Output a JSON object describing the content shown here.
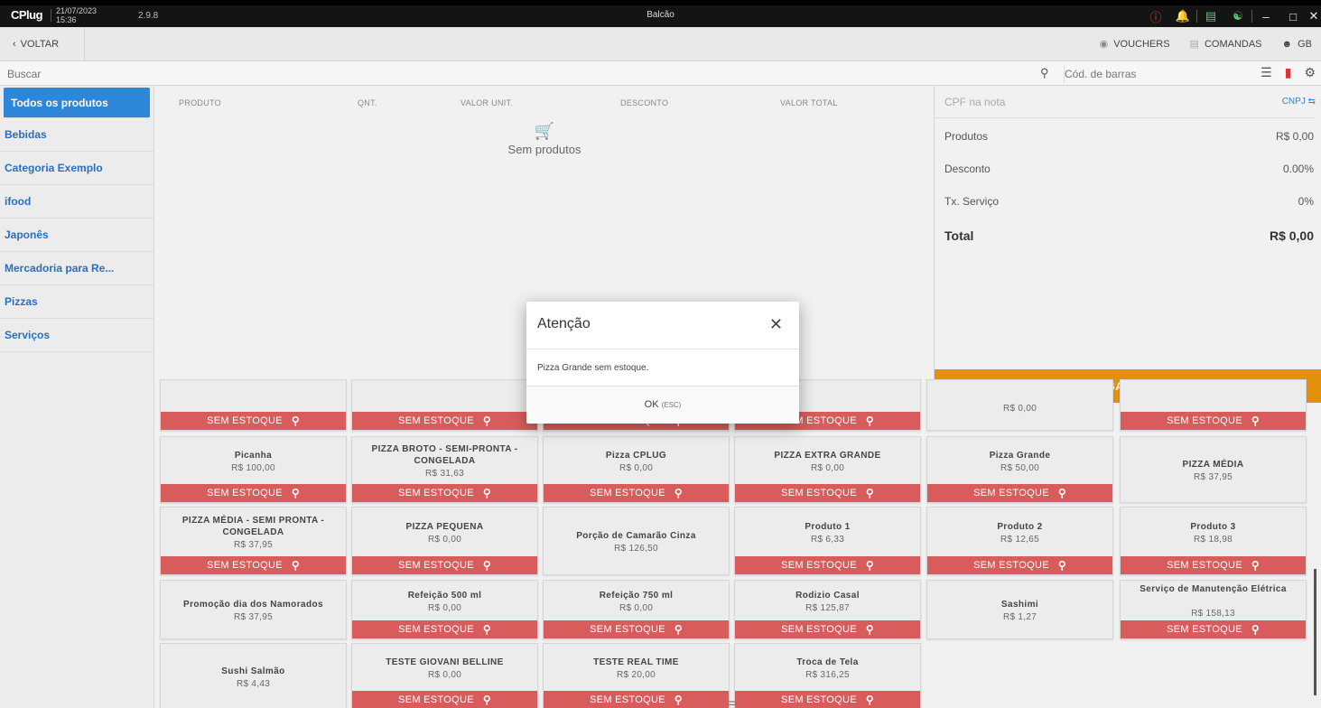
{
  "titlebar": {
    "logo": "CPlug",
    "date": "21/07/2023",
    "time": "15:36",
    "version": "2.9.8",
    "title": "Balcão"
  },
  "nav": {
    "back": "VOLTAR",
    "vouchers": "VOUCHERS",
    "comandas": "COMANDAS",
    "user": "GB"
  },
  "search": {
    "placeholder": "Buscar",
    "barcode_placeholder": "Cód. de barras"
  },
  "categories": [
    "Todos os produtos",
    "Bebidas",
    "Categoria Exemplo",
    "ifood",
    "Japonês",
    "Mercadoria para Re...",
    "Pizzas",
    "Serviços"
  ],
  "order": {
    "headers": [
      "PRODUTO",
      "QNT.",
      "VALOR UNIT.",
      "DESCONTO",
      "VALOR TOTAL"
    ],
    "empty": "Sem produtos"
  },
  "summary": {
    "cpf_placeholder": "CPF na nota",
    "cnpj": "CNPJ",
    "produtos_label": "Produtos",
    "produtos_value": "R$ 0,00",
    "desconto_label": "Desconto",
    "desconto_value": "0.00%",
    "servico_label": "Tx. Serviço",
    "servico_value": "0%",
    "total_label": "Total",
    "total_value": "R$ 0,00",
    "pay": "PAGAMENTO"
  },
  "stock_label": "SEM ESTOQUE",
  "row0_price": "R$ 0,00",
  "products": [
    {
      "name": "Picanha",
      "price": "R$ 100,00"
    },
    {
      "name": "PIZZA BROTO - SEMI-PRONTA - CONGELADA",
      "price": "R$ 31,63"
    },
    {
      "name": "Pizza CPLUG",
      "price": "R$ 0,00"
    },
    {
      "name": "PIZZA EXTRA GRANDE",
      "price": "R$ 0,00"
    },
    {
      "name": "Pizza Grande",
      "price": "R$ 50,00"
    },
    {
      "name": "PIZZA MÉDIA",
      "price": "R$ 37,95"
    },
    {
      "name": "PIZZA MÉDIA - SEMI PRONTA - CONGELADA",
      "price": "R$ 37,95"
    },
    {
      "name": "PIZZA PEQUENA",
      "price": "R$ 0,00"
    },
    {
      "name": "Porção de Camarão Cinza",
      "price": "R$ 126,50"
    },
    {
      "name": "Produto 1",
      "price": "R$ 6,33"
    },
    {
      "name": "Produto 2",
      "price": "R$ 12,65"
    },
    {
      "name": "Produto 3",
      "price": "R$ 18,98"
    },
    {
      "name": "Promoção dia dos Namorados",
      "price": "R$ 37,95"
    },
    {
      "name": "Refeição 500 ml",
      "price": "R$ 0,00"
    },
    {
      "name": "Refeição 750 ml",
      "price": "R$ 0,00"
    },
    {
      "name": "Rodizio Casal",
      "price": "R$ 125,87"
    },
    {
      "name": "Sashimi",
      "price": "R$ 1,27"
    },
    {
      "name": "Serviço de Manutenção Elétrica",
      "price": "R$ 158,13"
    },
    {
      "name": "Sushi Salmão",
      "price": "R$ 4,43"
    },
    {
      "name": "TESTE GIOVANI BELLINE",
      "price": "R$ 0,00"
    },
    {
      "name": "TESTE REAL TIME",
      "price": "R$ 20,00"
    },
    {
      "name": "Troca de Tela",
      "price": "R$ 316,25"
    }
  ],
  "dialog": {
    "title": "Atenção",
    "message": "Pizza Grande sem estoque.",
    "ok": "OK",
    "esc": "(ESC)"
  },
  "colors": {
    "accent": "#2e86d9",
    "payment": "#e3900c",
    "no_stock": "#d95c5c"
  }
}
